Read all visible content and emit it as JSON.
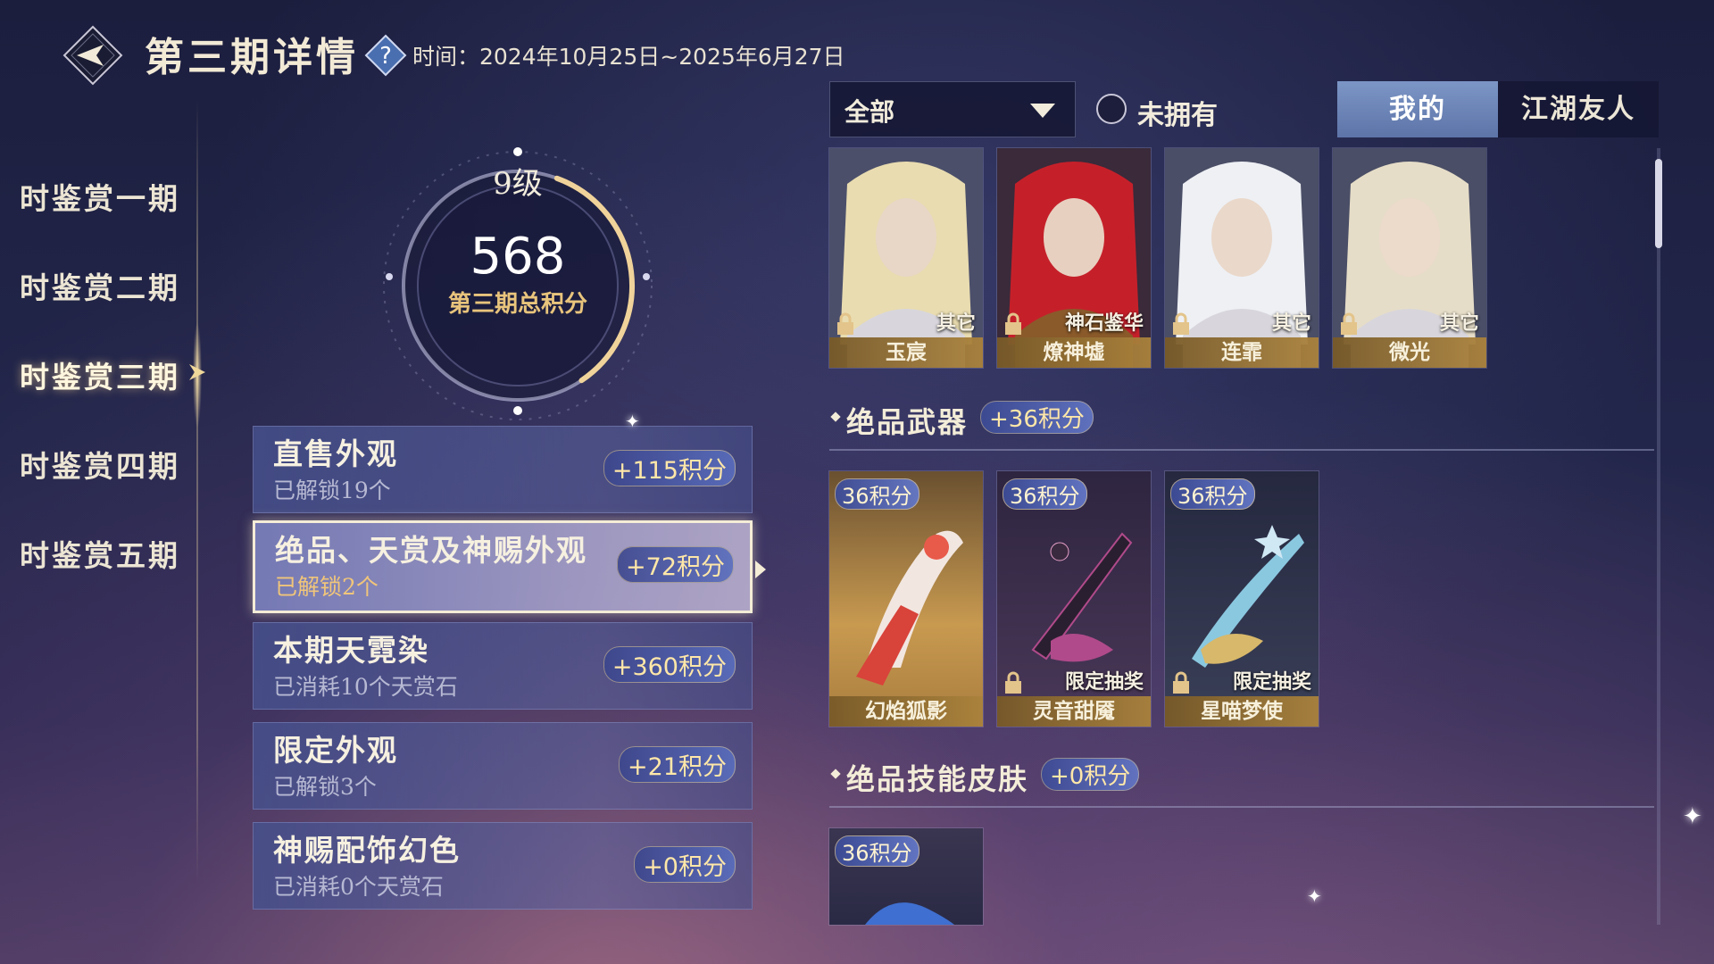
{
  "header": {
    "title": "第三期详情",
    "date_range": "时间：2024年10月25日~2025年6月27日"
  },
  "sidebar": {
    "items": [
      {
        "label": "时鉴赏一期",
        "active": false
      },
      {
        "label": "时鉴赏二期",
        "active": false
      },
      {
        "label": "时鉴赏三期",
        "active": true
      },
      {
        "label": "时鉴赏四期",
        "active": false
      },
      {
        "label": "时鉴赏五期",
        "active": false
      }
    ]
  },
  "score": {
    "level": "9级",
    "total": "568",
    "label": "第三期总积分",
    "progress": 0.35
  },
  "categories": [
    {
      "title": "直售外观",
      "sub": "已解锁19个",
      "points": "+115积分",
      "selected": false
    },
    {
      "title": "绝品、天赏及神赐外观",
      "sub": "已解锁2个",
      "points": "+72积分",
      "selected": true
    },
    {
      "title": "本期天霓染",
      "sub": "已消耗10个天赏石",
      "points": "+360积分",
      "selected": false
    },
    {
      "title": "限定外观",
      "sub": "已解锁3个",
      "points": "+21积分",
      "selected": false
    },
    {
      "title": "神赐配饰幻色",
      "sub": "已消耗0个天赏石",
      "points": "+0积分",
      "selected": false
    }
  ],
  "filters": {
    "dropdown_value": "全部",
    "unowned_label": "未拥有",
    "unowned_checked": false,
    "tabs": [
      {
        "label": "我的",
        "active": true
      },
      {
        "label": "江湖友人",
        "active": false
      }
    ]
  },
  "characters": [
    {
      "name": "玉宸",
      "tag": "其它",
      "hair": "#e9dcb0",
      "locked": true
    },
    {
      "name": "燎神墟",
      "tag": "神石鉴华",
      "hair": "#c5202a",
      "locked": true
    },
    {
      "name": "连霏",
      "tag": "其它",
      "hair": "#eef0f4",
      "locked": true
    },
    {
      "name": "微光",
      "tag": "其它",
      "hair": "#e6ddc8",
      "locked": true
    }
  ],
  "sections": {
    "weapons": {
      "title": "绝品武器",
      "points": "+36积分"
    },
    "skill_skins": {
      "title": "绝品技能皮肤",
      "points": "+0积分"
    }
  },
  "weapons": [
    {
      "name": "幻焰狐影",
      "points": "36积分",
      "tag": "",
      "owned": true,
      "accent": "#d8433a"
    },
    {
      "name": "灵音甜魇",
      "points": "36积分",
      "tag": "限定抽奖",
      "owned": false,
      "accent": "#b04a8a"
    },
    {
      "name": "星喵梦使",
      "points": "36积分",
      "tag": "限定抽奖",
      "owned": false,
      "accent": "#6fb7d6"
    }
  ],
  "skill_skins": [
    {
      "points": "36积分"
    }
  ],
  "colors": {
    "accent_gold": "#e8c47c",
    "badge_text": "#ffe7a8",
    "tab_active": "#7c96c6"
  }
}
